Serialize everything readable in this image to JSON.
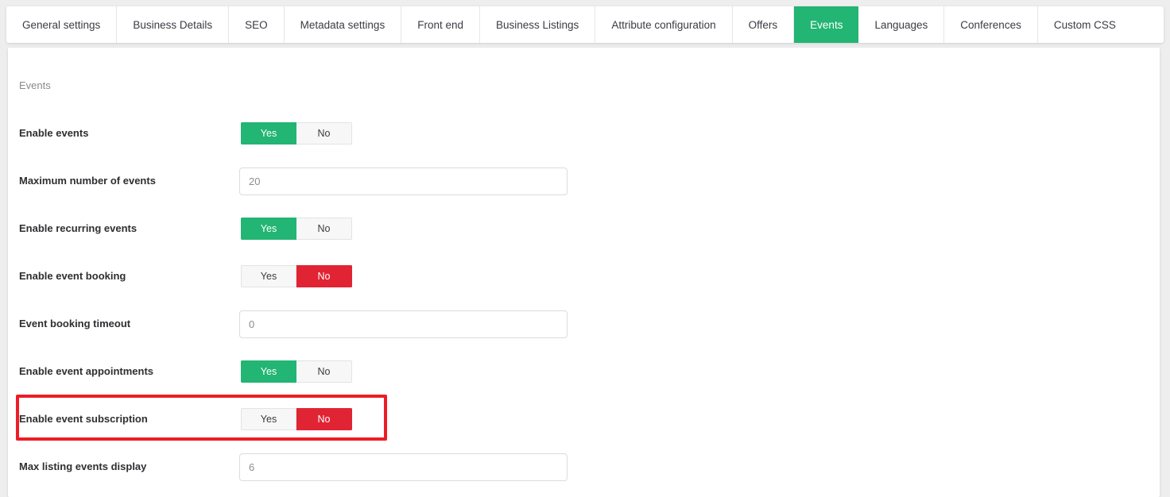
{
  "tabs": [
    {
      "label": "General settings",
      "active": false
    },
    {
      "label": "Business Details",
      "active": false
    },
    {
      "label": "SEO",
      "active": false
    },
    {
      "label": "Metadata settings",
      "active": false
    },
    {
      "label": "Front end",
      "active": false
    },
    {
      "label": "Business Listings",
      "active": false
    },
    {
      "label": "Attribute configuration",
      "active": false
    },
    {
      "label": "Offers",
      "active": false
    },
    {
      "label": "Events",
      "active": true
    },
    {
      "label": "Languages",
      "active": false
    },
    {
      "label": "Conferences",
      "active": false
    },
    {
      "label": "Custom CSS",
      "active": false
    }
  ],
  "panel": {
    "heading": "Events",
    "rows": [
      {
        "label": "Enable events",
        "type": "toggle",
        "yes_label": "Yes",
        "no_label": "No",
        "value": "Yes"
      },
      {
        "label": "Maximum number of events",
        "type": "input",
        "value": "20"
      },
      {
        "label": "Enable recurring events",
        "type": "toggle",
        "yes_label": "Yes",
        "no_label": "No",
        "value": "Yes"
      },
      {
        "label": "Enable event booking",
        "type": "toggle",
        "yes_label": "Yes",
        "no_label": "No",
        "value": "No"
      },
      {
        "label": "Event booking timeout",
        "type": "input",
        "value": "0"
      },
      {
        "label": "Enable event appointments",
        "type": "toggle",
        "yes_label": "Yes",
        "no_label": "No",
        "value": "Yes",
        "highlighted": true
      },
      {
        "label": "Enable event subscription",
        "type": "toggle",
        "yes_label": "Yes",
        "no_label": "No",
        "value": "No"
      },
      {
        "label": "Max listing events display",
        "type": "input",
        "value": "6"
      }
    ]
  },
  "colors": {
    "accent_green": "#22b573",
    "accent_red": "#e02434",
    "highlight_red": "#ee1c25",
    "page_background": "#eeeeee",
    "label_text": "#2f2f33",
    "heading_text": "#8a8a8a"
  }
}
